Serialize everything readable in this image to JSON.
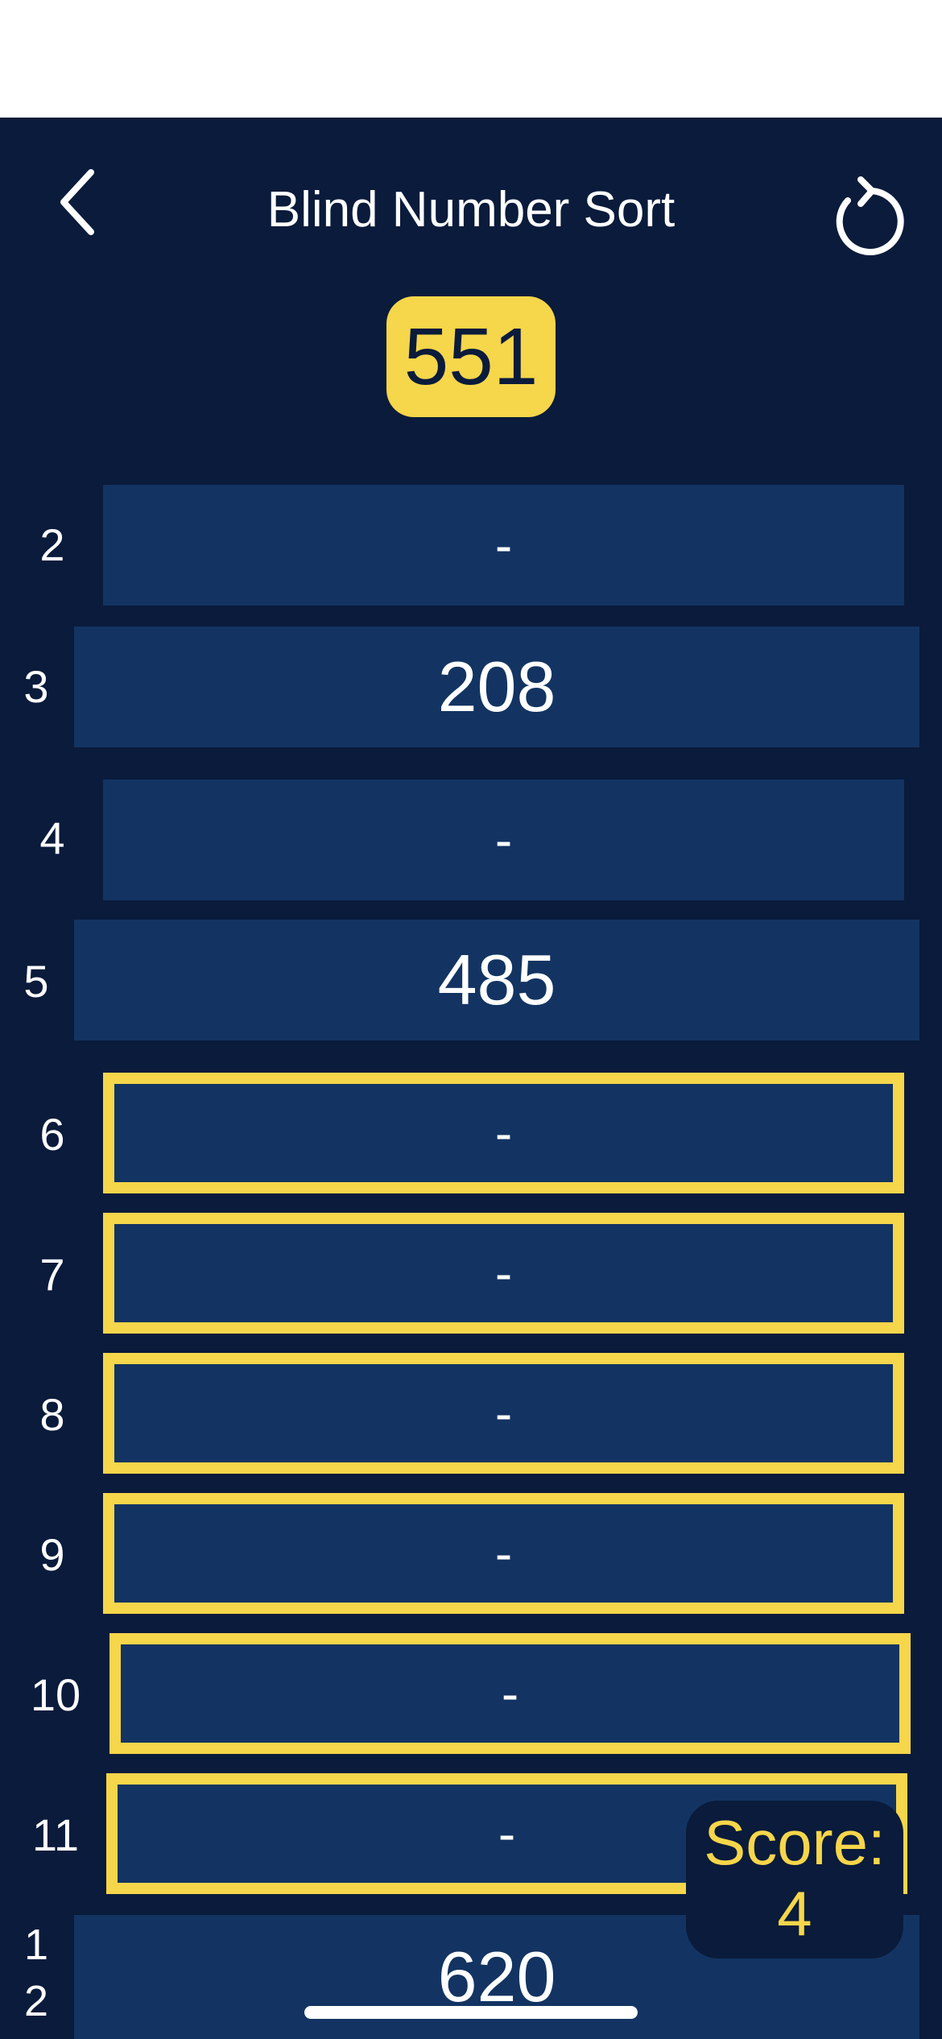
{
  "header": {
    "title": "Blind Number Sort",
    "back_icon": "chevron-left-icon",
    "restart_icon": "restart-icon"
  },
  "current_number": "551",
  "slots": [
    {
      "label": "2",
      "value": "-"
    },
    {
      "label": "3",
      "value": "208"
    },
    {
      "label": "4",
      "value": "-"
    },
    {
      "label": "5",
      "value": "485"
    },
    {
      "label": "6",
      "value": "-"
    },
    {
      "label": "7",
      "value": "-"
    },
    {
      "label": "8",
      "value": "-"
    },
    {
      "label": "9",
      "value": "-"
    },
    {
      "label": "10",
      "value": "-"
    },
    {
      "label": "11",
      "value": "-"
    },
    {
      "label_line1": "1",
      "label_line2": "2",
      "value": "620"
    }
  ],
  "score": {
    "label": "Score:",
    "value": "4"
  },
  "colors": {
    "background": "#0a1b3b",
    "slot": "#133462",
    "accent": "#f6d64a",
    "text": "#ffffff"
  }
}
